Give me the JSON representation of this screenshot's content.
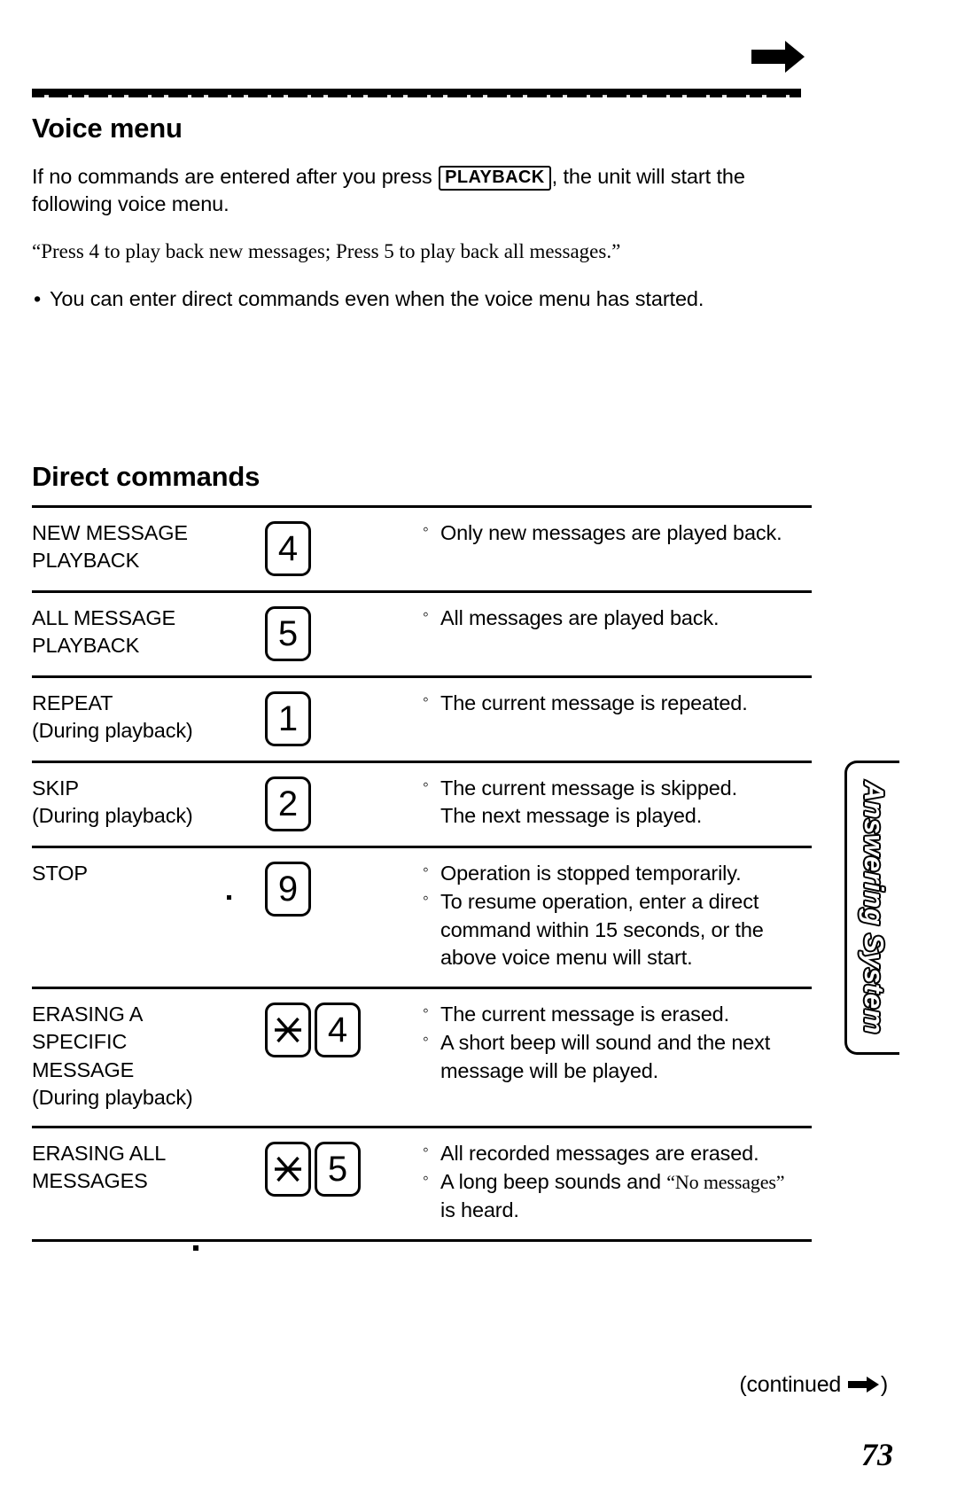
{
  "page": {
    "number": "73",
    "continued_label": "(continued",
    "continued_close": ")",
    "side_tab_label": "Answering System"
  },
  "voice_menu": {
    "title": "Voice menu",
    "intro_before": "If no commands are entered after you press",
    "playback_key": "PLAYBACK",
    "intro_after": ", the unit will start the following voice menu.",
    "quote": "“Press 4 to play back new messages; Press 5 to play back all messages.”",
    "note_bullet": "•",
    "note": "You can enter direct commands even when the voice menu has started."
  },
  "direct_commands": {
    "title": "Direct commands",
    "rows": [
      {
        "name": "NEW MESSAGE",
        "name_line2": "PLAYBACK",
        "keys": [
          "4"
        ],
        "desc": [
          {
            "bullet": "◦",
            "text": "Only new messages are played back."
          }
        ]
      },
      {
        "name": "ALL MESSAGE",
        "name_line2": "PLAYBACK",
        "keys": [
          "5"
        ],
        "desc": [
          {
            "bullet": "◦",
            "text": "All messages are played back."
          }
        ]
      },
      {
        "name": "REPEAT",
        "name_line2": "(During playback)",
        "keys": [
          "1"
        ],
        "desc": [
          {
            "bullet": "◦",
            "text": "The current message is repeated."
          }
        ]
      },
      {
        "name": "SKIP",
        "name_line2": "(During playback)",
        "keys": [
          "2"
        ],
        "desc": [
          {
            "bullet": "◦",
            "text": "The current message is skipped.",
            "cont": "The next message is played."
          }
        ]
      },
      {
        "name": "STOP",
        "name_line2": "",
        "keys": [
          "9"
        ],
        "desc": [
          {
            "bullet": "◦",
            "text": "Operation is stopped temporarily."
          },
          {
            "bullet": "◦",
            "text": "To resume operation, enter a direct",
            "cont": "command within 15 seconds, or the above voice menu will start."
          }
        ]
      },
      {
        "name": "ERASING A",
        "name_line2": "SPECIFIC",
        "name_line3": "MESSAGE",
        "name_line4": "(During playback)",
        "keys": [
          "star-key",
          "4"
        ],
        "desc": [
          {
            "bullet": "◦",
            "text": "The current message is erased."
          },
          {
            "bullet": "◦",
            "text": "A short beep will sound and the next",
            "cont": "message will be played."
          }
        ]
      },
      {
        "name": "ERASING ALL",
        "name_line2": "MESSAGES",
        "keys": [
          "star-key",
          "5"
        ],
        "desc": [
          {
            "bullet": "◦",
            "text": "All recorded messages are erased."
          },
          {
            "bullet": "◦",
            "text_pre": "A long beep sounds and ",
            "quoted": "“No messages”",
            "cont": "is heard."
          }
        ]
      }
    ]
  }
}
